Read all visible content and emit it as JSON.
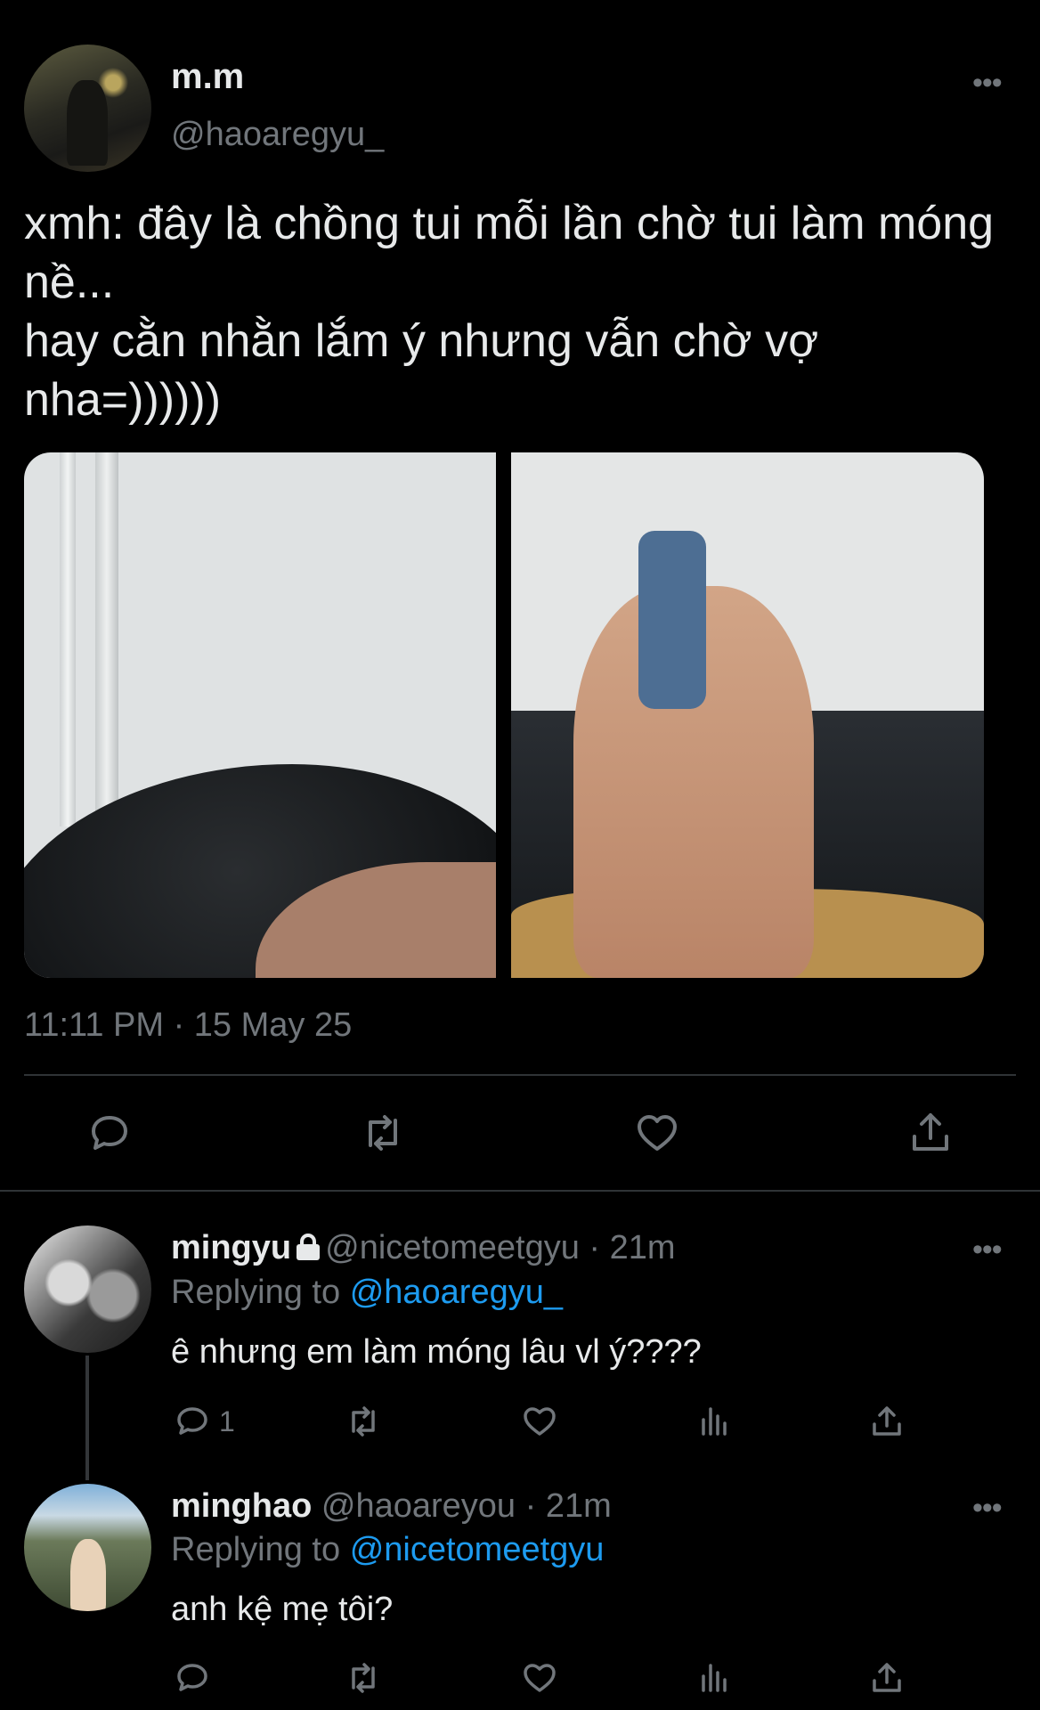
{
  "main_tweet": {
    "name": "m.m",
    "handle": "@haoaregyu_",
    "more_label": "•••",
    "text": "xmh: đây là chồng tui mỗi lần chờ tui làm móng nề...\nhay cằn nhằn lắm ý nhưng vẫn chờ vợ nha=))))))",
    "timestamp": "11:11 PM · 15 May 25",
    "photos": [
      "photo-left",
      "photo-right"
    ]
  },
  "replies": [
    {
      "name": "mingyu",
      "protected": true,
      "handle": "@nicetomeetgyu",
      "time": "· 21m",
      "replying_prefix": "Replying to",
      "replying_to": "@haoaregyu_",
      "text": "ê nhưng em làm móng lâu vl ý????",
      "reply_count": "1",
      "more_label": "•••"
    },
    {
      "name": "minghao",
      "protected": false,
      "handle": "@haoareyou",
      "time": "· 21m",
      "replying_prefix": "Replying to",
      "replying_to": "@nicetomeetgyu",
      "text": "anh kệ mẹ tôi?",
      "reply_count": "",
      "more_label": "•••"
    }
  ],
  "icons": {
    "reply": "reply-icon",
    "retweet": "retweet-icon",
    "like": "heart-icon",
    "views": "views-icon",
    "share": "share-icon",
    "more": "more-icon"
  },
  "colors": {
    "background": "#000000",
    "text": "#e7e9ea",
    "muted": "#71767b",
    "link": "#1d9bf0",
    "divider": "#2f3336"
  }
}
